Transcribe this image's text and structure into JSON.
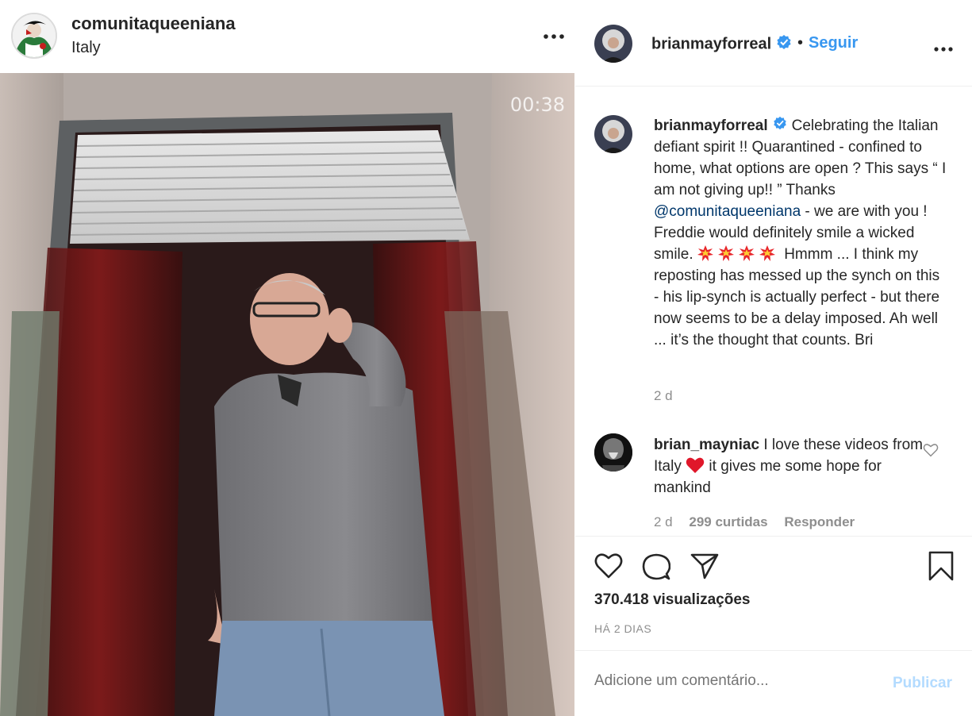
{
  "post_header": {
    "username": "comunitaqueeniana",
    "location": "Italy",
    "more_icon": "more-horizontal-icon"
  },
  "video": {
    "timer": "00:38"
  },
  "author_header": {
    "username": "brianmayforreal",
    "separator": "•",
    "follow_label": "Seguir",
    "verified_icon": "verified-badge-icon",
    "more_icon": "more-horizontal-icon"
  },
  "caption": {
    "username": "brianmayforreal",
    "text_before_mention": "Celebrating the Italian defiant spirit !! Quarantined - confined to home, what options are open ? This says “ I am not giving up!! ” Thanks ",
    "mention": "@comunitaqueeniana",
    "text_after_mention": " - we are with you ! Freddie would definitely smile a wicked smile.",
    "emoji_icon": "collision-emoji-icon",
    "emoji_count": 4,
    "text_after_emoji": "Hmmm ... I think my reposting has messed up the synch on this - his lip-synch is actually perfect - but there now seems to be a delay imposed. Ah well ... it’s the thought that counts. Bri",
    "time": "2 d"
  },
  "comment": {
    "username": "brian_mayniac",
    "text_before_heart": "I love these videos from Italy",
    "heart_icon": "red-heart-emoji-icon",
    "text_after_heart": " it gives me some hope for mankind",
    "time": "2 d",
    "likes": "299 curtidas",
    "reply_label": "Responder",
    "like_icon": "heart-outline-icon"
  },
  "actions": {
    "like_icon": "heart-outline-icon",
    "comment_icon": "comment-bubble-icon",
    "share_icon": "paper-plane-icon",
    "save_icon": "bookmark-icon",
    "views": "370.418 visualizações",
    "date": "HÁ 2 DIAS"
  },
  "comment_bar": {
    "placeholder": "Adicione um comentário...",
    "publish_label": "Publicar"
  },
  "colors": {
    "link_blue": "#3897f0",
    "mention_blue": "#00376b",
    "publish_disabled": "#b3dbff",
    "muted_text": "#8e8e8e",
    "border": "#dbdbdb"
  }
}
